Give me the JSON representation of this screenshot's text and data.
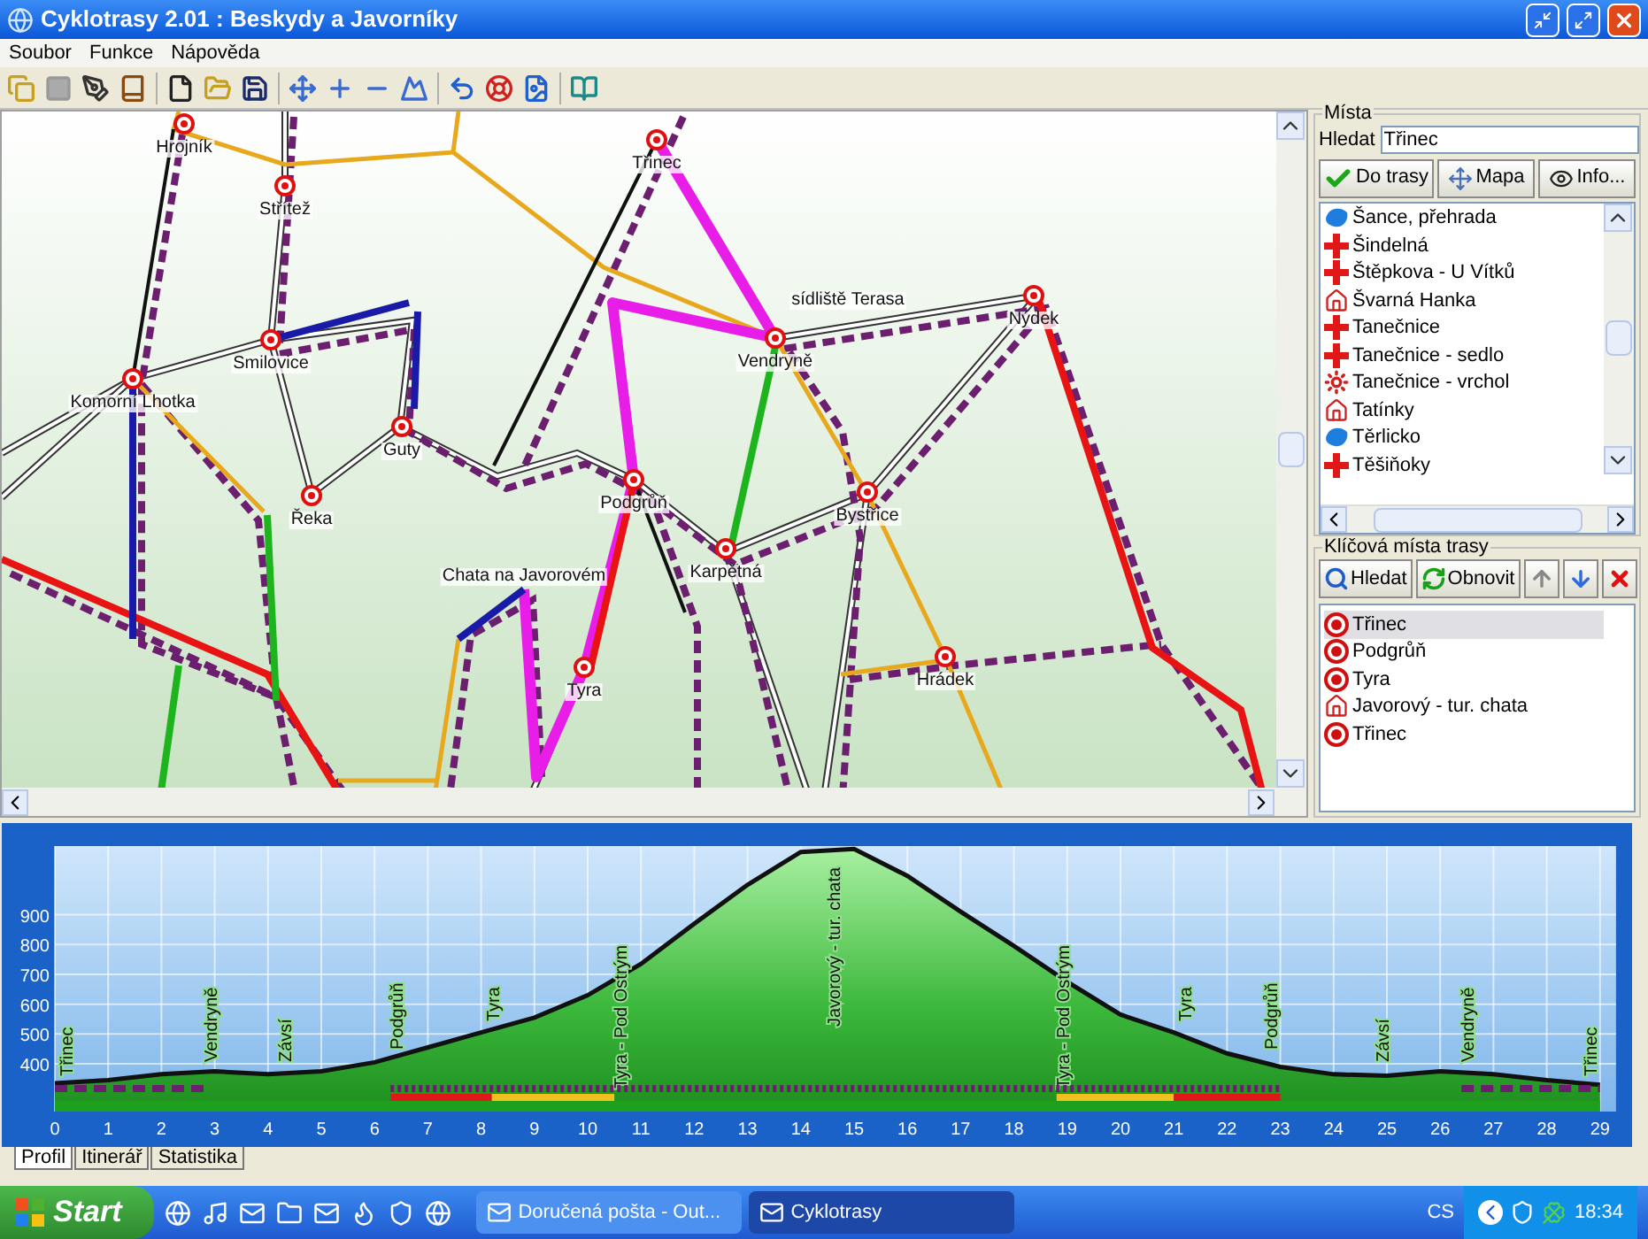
{
  "window": {
    "title": "Cyklotrasy 2.01 : Beskydy a Javorníky"
  },
  "menu": [
    "Soubor",
    "Funkce",
    "Nápověda"
  ],
  "map": {
    "places": [
      {
        "name": "Hrojník",
        "kind": "pin"
      },
      {
        "name": "Střítež",
        "kind": "pin"
      },
      {
        "name": "Třinec",
        "kind": "pin"
      },
      {
        "name": "sídliště Terasa",
        "kind": "label"
      },
      {
        "name": "Nýdek",
        "kind": "pin"
      },
      {
        "name": "Smilovice",
        "kind": "pin"
      },
      {
        "name": "Komorní Lhotka",
        "kind": "pin"
      },
      {
        "name": "Vendryně",
        "kind": "pin"
      },
      {
        "name": "Guty",
        "kind": "pin"
      },
      {
        "name": "Řeka",
        "kind": "pin"
      },
      {
        "name": "Podgrůň",
        "kind": "pin"
      },
      {
        "name": "Karpětná",
        "kind": "pin"
      },
      {
        "name": "Bystřice",
        "kind": "pin"
      },
      {
        "name": "Chata na Javorovém",
        "kind": "label"
      },
      {
        "name": "Tyra",
        "kind": "pin"
      },
      {
        "name": "Hrádek",
        "kind": "pin"
      }
    ]
  },
  "places_panel": {
    "title": "Místa",
    "search": {
      "label": "Hledat",
      "value": "Třinec"
    },
    "buttons": [
      {
        "label": "Do trasy",
        "kind": "add"
      },
      {
        "label": "Mapa",
        "kind": "map"
      },
      {
        "label": "Info...",
        "kind": "info"
      }
    ],
    "items": [
      {
        "name": "Šance, přehrada",
        "kind": "lake"
      },
      {
        "name": "Šindelná",
        "kind": "cross"
      },
      {
        "name": "Štěpkova - U Vítků",
        "kind": "cross"
      },
      {
        "name": "Švarná Hanka",
        "kind": "house"
      },
      {
        "name": "Tanečnice",
        "kind": "cross"
      },
      {
        "name": "Tanečnice - sedlo",
        "kind": "cross"
      },
      {
        "name": "Tanečnice - vrchol",
        "kind": "sun"
      },
      {
        "name": "Tatínky",
        "kind": "house"
      },
      {
        "name": "Těrlicko",
        "kind": "lake"
      },
      {
        "name": "Těšiňoky",
        "kind": "cross"
      }
    ]
  },
  "route_panel": {
    "title": "Klíčová místa trasy",
    "buttons": [
      {
        "label": "Hledat",
        "kind": "search"
      },
      {
        "label": "Obnovit",
        "kind": "refresh"
      },
      {
        "kind": "up"
      },
      {
        "kind": "down"
      },
      {
        "kind": "delete"
      }
    ],
    "items": [
      {
        "name": "Třinec",
        "kind": "point",
        "selected": true
      },
      {
        "name": "Podgrůň",
        "kind": "point",
        "selected": false
      },
      {
        "name": "Tyra",
        "kind": "point",
        "selected": false
      },
      {
        "name": "Javorový - tur. chata",
        "kind": "house",
        "selected": false
      },
      {
        "name": "Třinec",
        "kind": "point",
        "selected": false
      }
    ]
  },
  "profile": {
    "chart_data": {
      "type": "area",
      "x": [
        0,
        1,
        2,
        3,
        4,
        5,
        6,
        7,
        8,
        9,
        10,
        11,
        12,
        13,
        14,
        15,
        16,
        17,
        18,
        19,
        20,
        21,
        22,
        23,
        24,
        25,
        26,
        27,
        28,
        29
      ],
      "values": [
        335,
        345,
        365,
        375,
        365,
        375,
        405,
        455,
        505,
        555,
        630,
        735,
        870,
        1000,
        1110,
        1120,
        1030,
        910,
        795,
        675,
        565,
        505,
        435,
        390,
        365,
        360,
        375,
        365,
        345,
        330
      ],
      "xlim": [
        0,
        29.3
      ],
      "ylim": [
        240,
        1130
      ],
      "xticks": [
        0,
        1,
        2,
        3,
        4,
        5,
        6,
        7,
        8,
        9,
        10,
        11,
        12,
        13,
        14,
        15,
        16,
        17,
        18,
        19,
        20,
        21,
        22,
        23,
        24,
        25,
        26,
        27,
        28,
        29
      ],
      "yticks": [
        400,
        500,
        600,
        700,
        800,
        900
      ],
      "grid": true,
      "annotations": [
        "Třinec",
        "Vendryně",
        "Závsí",
        "Podgrůň",
        "Tyra",
        "Tyra - Pod Ostrým",
        "Javorový - tur. chata",
        "Tyra - Pod Ostrým",
        "Tyra",
        "Podgrůň",
        "Závsí",
        "Vendryně",
        "Třinec"
      ]
    }
  },
  "tabs": [
    {
      "label": "Profil",
      "selected": true
    },
    {
      "label": "Itinerář",
      "selected": false
    },
    {
      "label": "Statistika",
      "selected": false
    }
  ],
  "taskbar": {
    "start": "Start",
    "tasks": [
      {
        "label": "Doručená pošta - Out...",
        "selected": false
      },
      {
        "label": "Cyklotrasy",
        "selected": true
      }
    ],
    "language": "CS",
    "clock": "18:34"
  }
}
